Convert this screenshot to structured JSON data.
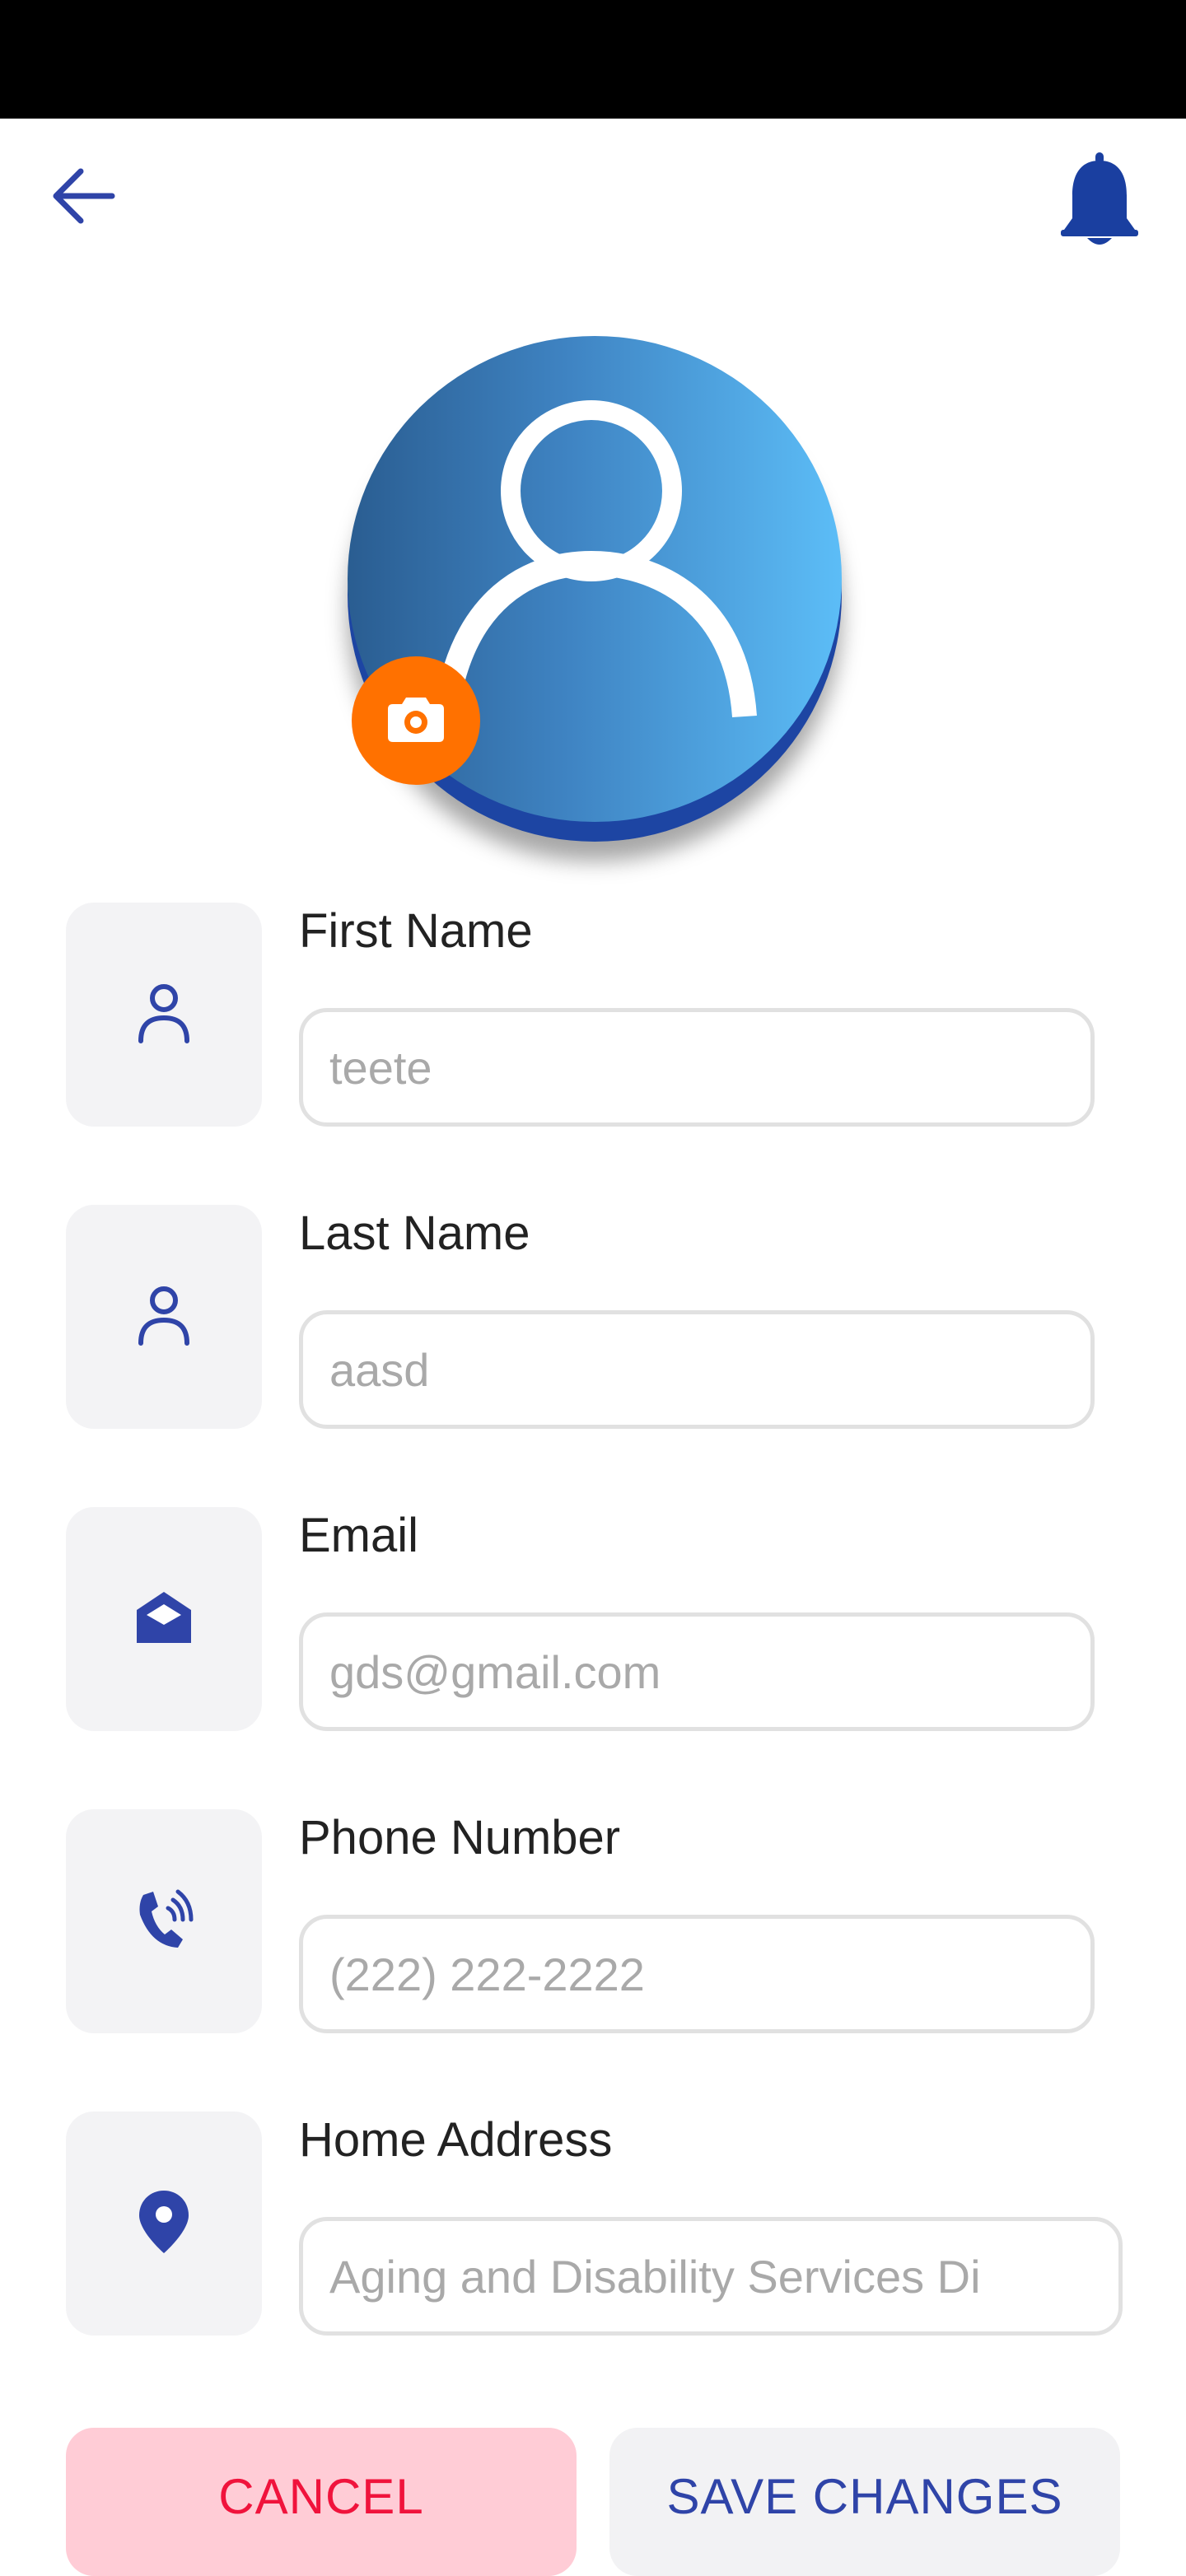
{
  "header": {
    "back_icon": "arrow-left-icon",
    "notification_icon": "bell-icon"
  },
  "profile": {
    "avatar_icon": "user-avatar-icon",
    "camera_icon": "camera-icon",
    "camera_color": "#ff7100"
  },
  "fields": [
    {
      "label": "First Name",
      "placeholder": "teete",
      "icon": "user-icon"
    },
    {
      "label": "Last Name",
      "placeholder": "aasd",
      "icon": "user-icon"
    },
    {
      "label": "Email",
      "placeholder": "gds@gmail.com",
      "icon": "envelope-open-icon"
    },
    {
      "label": "Phone Number",
      "placeholder": "(222) 222-2222",
      "icon": "phone-ringing-icon"
    },
    {
      "label": "Home Address",
      "placeholder": "Aging and Disability Services Di",
      "icon": "location-pin-icon"
    }
  ],
  "actions": {
    "cancel_label": "CANCEL",
    "save_label": "SAVE CHANGES"
  },
  "colors": {
    "accent": "#2f44a8",
    "cancel_text": "#f0133c",
    "cancel_bg": "#ffccd6"
  }
}
